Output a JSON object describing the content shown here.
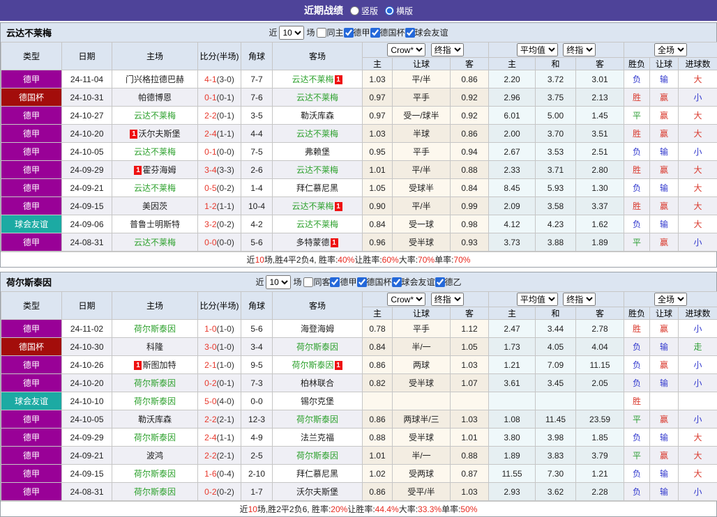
{
  "top": {
    "title": "近期战绩",
    "radios": [
      {
        "label": "竖版",
        "checked": false
      },
      {
        "label": "横版",
        "checked": true
      }
    ]
  },
  "colors": {
    "topbar": "#4e4399",
    "header_bg": "#dce5f1",
    "team_green": "#2da12d",
    "score_red": "#e8382c",
    "badge_red": "#ee1111",
    "summary_red": "#e8281e",
    "type_map": {
      "德甲": "#990197",
      "德国杯": "#a30d0b",
      "球会友谊": "#1caaa3"
    },
    "result_map": {
      "胜": "#d9382c",
      "赢": "#d9382c",
      "大": "#d9382c",
      "负": "#3037cd",
      "输": "#3037cd",
      "小": "#3037cd",
      "平": "#2d9e35",
      "走": "#2d9e35"
    }
  },
  "sections": [
    {
      "team": "云达不莱梅",
      "filter": {
        "near_label": "近",
        "count": "10",
        "games_label": "场",
        "checkboxes": [
          {
            "label": "同主",
            "checked": false
          },
          {
            "label": "德甲",
            "checked": true
          },
          {
            "label": "德国杯",
            "checked": true
          },
          {
            "label": "球会友谊",
            "checked": true
          }
        ]
      },
      "header": {
        "cols": [
          "类型",
          "日期",
          "主场",
          "比分(半场)",
          "角球",
          "客场"
        ],
        "selects": {
          "crow": "Crow*",
          "crow_final": "终指",
          "avg": "平均值",
          "avg_final": "终指",
          "scope": "全场"
        },
        "subs": [
          "主",
          "让球",
          "客",
          "主",
          "和",
          "客",
          "胜负",
          "让球",
          "进球数"
        ]
      },
      "rows": [
        {
          "type": "德甲",
          "date": "24-11-04",
          "home": "门兴格拉德巴赫",
          "home_green": false,
          "home_badge": "none",
          "score": "4-1",
          "half": "(3-0)",
          "corners": "7-7",
          "away": "云达不莱梅",
          "away_green": true,
          "away_badge": "after",
          "odds": [
            "1.03",
            "平/半",
            "0.86"
          ],
          "avg": [
            "2.20",
            "3.72",
            "3.01"
          ],
          "results": [
            "负",
            "输",
            "大"
          ]
        },
        {
          "type": "德国杯",
          "date": "24-10-31",
          "home": "帕德博恩",
          "home_green": false,
          "home_badge": "none",
          "score": "0-1",
          "half": "(0-1)",
          "corners": "7-6",
          "away": "云达不莱梅",
          "away_green": true,
          "away_badge": "none",
          "odds": [
            "0.97",
            "平手",
            "0.92"
          ],
          "avg": [
            "2.96",
            "3.75",
            "2.13"
          ],
          "results": [
            "胜",
            "赢",
            "小"
          ]
        },
        {
          "type": "德甲",
          "date": "24-10-27",
          "home": "云达不莱梅",
          "home_green": true,
          "home_badge": "none",
          "score": "2-2",
          "half": "(0-1)",
          "corners": "3-5",
          "away": "勒沃库森",
          "away_green": false,
          "away_badge": "none",
          "odds": [
            "0.97",
            "受一/球半",
            "0.92"
          ],
          "avg": [
            "6.01",
            "5.00",
            "1.45"
          ],
          "results": [
            "平",
            "赢",
            "大"
          ]
        },
        {
          "type": "德甲",
          "date": "24-10-20",
          "home": "沃尔夫斯堡",
          "home_green": false,
          "home_badge": "before",
          "score": "2-4",
          "half": "(1-1)",
          "corners": "4-4",
          "away": "云达不莱梅",
          "away_green": true,
          "away_badge": "none",
          "odds": [
            "1.03",
            "半球",
            "0.86"
          ],
          "avg": [
            "2.00",
            "3.70",
            "3.51"
          ],
          "results": [
            "胜",
            "赢",
            "大"
          ]
        },
        {
          "type": "德甲",
          "date": "24-10-05",
          "home": "云达不莱梅",
          "home_green": true,
          "home_badge": "none",
          "score": "0-1",
          "half": "(0-0)",
          "corners": "7-5",
          "away": "弗赖堡",
          "away_green": false,
          "away_badge": "none",
          "odds": [
            "0.95",
            "平手",
            "0.94"
          ],
          "avg": [
            "2.67",
            "3.53",
            "2.51"
          ],
          "results": [
            "负",
            "输",
            "小"
          ]
        },
        {
          "type": "德甲",
          "date": "24-09-29",
          "home": "霍芬海姆",
          "home_green": false,
          "home_badge": "before",
          "score": "3-4",
          "half": "(3-3)",
          "corners": "2-6",
          "away": "云达不莱梅",
          "away_green": true,
          "away_badge": "none",
          "odds": [
            "1.01",
            "平/半",
            "0.88"
          ],
          "avg": [
            "2.33",
            "3.71",
            "2.80"
          ],
          "results": [
            "胜",
            "赢",
            "大"
          ]
        },
        {
          "type": "德甲",
          "date": "24-09-21",
          "home": "云达不莱梅",
          "home_green": true,
          "home_badge": "none",
          "score": "0-5",
          "half": "(0-2)",
          "corners": "1-4",
          "away": "拜仁慕尼黑",
          "away_green": false,
          "away_badge": "none",
          "odds": [
            "1.05",
            "受球半",
            "0.84"
          ],
          "avg": [
            "8.45",
            "5.93",
            "1.30"
          ],
          "results": [
            "负",
            "输",
            "大"
          ]
        },
        {
          "type": "德甲",
          "date": "24-09-15",
          "home": "美因茨",
          "home_green": false,
          "home_badge": "none",
          "score": "1-2",
          "half": "(1-1)",
          "corners": "10-4",
          "away": "云达不莱梅",
          "away_green": true,
          "away_badge": "after",
          "odds": [
            "0.90",
            "平/半",
            "0.99"
          ],
          "avg": [
            "2.09",
            "3.58",
            "3.37"
          ],
          "results": [
            "胜",
            "赢",
            "大"
          ]
        },
        {
          "type": "球会友谊",
          "date": "24-09-06",
          "home": "普鲁士明斯特",
          "home_green": false,
          "home_badge": "none",
          "score": "3-2",
          "half": "(0-2)",
          "corners": "4-2",
          "away": "云达不莱梅",
          "away_green": true,
          "away_badge": "none",
          "odds": [
            "0.84",
            "受一球",
            "0.98"
          ],
          "avg": [
            "4.12",
            "4.23",
            "1.62"
          ],
          "results": [
            "负",
            "输",
            "大"
          ]
        },
        {
          "type": "德甲",
          "date": "24-08-31",
          "home": "云达不莱梅",
          "home_green": true,
          "home_badge": "none",
          "score": "0-0",
          "half": "(0-0)",
          "corners": "5-6",
          "away": "多特蒙德",
          "away_green": false,
          "away_badge": "after",
          "odds": [
            "0.96",
            "受半球",
            "0.93"
          ],
          "avg": [
            "3.73",
            "3.88",
            "1.89"
          ],
          "results": [
            "平",
            "赢",
            "小"
          ]
        }
      ],
      "summary": [
        {
          "t": "近",
          "red": false
        },
        {
          "t": "10",
          "red": true
        },
        {
          "t": "场,胜4平2负4, 胜率:",
          "red": false
        },
        {
          "t": "40%",
          "red": true
        },
        {
          "t": " 让胜率:",
          "red": false
        },
        {
          "t": "60%",
          "red": true
        },
        {
          "t": " 大率:",
          "red": false
        },
        {
          "t": "70%",
          "red": true
        },
        {
          "t": " 单率:",
          "red": false
        },
        {
          "t": "70%",
          "red": true
        }
      ]
    },
    {
      "team": "荷尔斯泰因",
      "filter": {
        "near_label": "近",
        "count": "10",
        "games_label": "场",
        "checkboxes": [
          {
            "label": "同客",
            "checked": false
          },
          {
            "label": "德甲",
            "checked": true
          },
          {
            "label": "德国杯",
            "checked": true
          },
          {
            "label": "球会友谊",
            "checked": true
          },
          {
            "label": "德乙",
            "checked": true
          }
        ]
      },
      "header": {
        "cols": [
          "类型",
          "日期",
          "主场",
          "比分(半场)",
          "角球",
          "客场"
        ],
        "selects": {
          "crow": "Crow*",
          "crow_final": "终指",
          "avg": "平均值",
          "avg_final": "终指",
          "scope": "全场"
        },
        "subs": [
          "主",
          "让球",
          "客",
          "主",
          "和",
          "客",
          "胜负",
          "让球",
          "进球数"
        ]
      },
      "rows": [
        {
          "type": "德甲",
          "date": "24-11-02",
          "home": "荷尔斯泰因",
          "home_green": true,
          "home_badge": "none",
          "score": "1-0",
          "half": "(1-0)",
          "corners": "5-6",
          "away": "海登海姆",
          "away_green": false,
          "away_badge": "none",
          "odds": [
            "0.78",
            "平手",
            "1.12"
          ],
          "avg": [
            "2.47",
            "3.44",
            "2.78"
          ],
          "results": [
            "胜",
            "赢",
            "小"
          ]
        },
        {
          "type": "德国杯",
          "date": "24-10-30",
          "home": "科隆",
          "home_green": false,
          "home_badge": "none",
          "score": "3-0",
          "half": "(1-0)",
          "corners": "3-4",
          "away": "荷尔斯泰因",
          "away_green": true,
          "away_badge": "none",
          "odds": [
            "0.84",
            "半/一",
            "1.05"
          ],
          "avg": [
            "1.73",
            "4.05",
            "4.04"
          ],
          "results": [
            "负",
            "输",
            "走"
          ]
        },
        {
          "type": "德甲",
          "date": "24-10-26",
          "home": "斯图加特",
          "home_green": false,
          "home_badge": "before",
          "score": "2-1",
          "half": "(1-0)",
          "corners": "9-5",
          "away": "荷尔斯泰因",
          "away_green": true,
          "away_badge": "after",
          "odds": [
            "0.86",
            "两球",
            "1.03"
          ],
          "avg": [
            "1.21",
            "7.09",
            "11.15"
          ],
          "results": [
            "负",
            "赢",
            "小"
          ]
        },
        {
          "type": "德甲",
          "date": "24-10-20",
          "home": "荷尔斯泰因",
          "home_green": true,
          "home_badge": "none",
          "score": "0-2",
          "half": "(0-1)",
          "corners": "7-3",
          "away": "柏林联合",
          "away_green": false,
          "away_badge": "none",
          "odds": [
            "0.82",
            "受半球",
            "1.07"
          ],
          "avg": [
            "3.61",
            "3.45",
            "2.05"
          ],
          "results": [
            "负",
            "输",
            "小"
          ]
        },
        {
          "type": "球会友谊",
          "date": "24-10-10",
          "home": "荷尔斯泰因",
          "home_green": true,
          "home_badge": "none",
          "score": "5-0",
          "half": "(4-0)",
          "corners": "0-0",
          "away": "锡尔克堡",
          "away_green": false,
          "away_badge": "none",
          "odds": [
            "",
            "",
            ""
          ],
          "avg": [
            "",
            "",
            ""
          ],
          "results": [
            "胜",
            "",
            ""
          ]
        },
        {
          "type": "德甲",
          "date": "24-10-05",
          "home": "勒沃库森",
          "home_green": false,
          "home_badge": "none",
          "score": "2-2",
          "half": "(2-1)",
          "corners": "12-3",
          "away": "荷尔斯泰因",
          "away_green": true,
          "away_badge": "none",
          "odds": [
            "0.86",
            "两球半/三",
            "1.03"
          ],
          "avg": [
            "1.08",
            "11.45",
            "23.59"
          ],
          "results": [
            "平",
            "赢",
            "小"
          ]
        },
        {
          "type": "德甲",
          "date": "24-09-29",
          "home": "荷尔斯泰因",
          "home_green": true,
          "home_badge": "none",
          "score": "2-4",
          "half": "(1-1)",
          "corners": "4-9",
          "away": "法兰克福",
          "away_green": false,
          "away_badge": "none",
          "odds": [
            "0.88",
            "受半球",
            "1.01"
          ],
          "avg": [
            "3.80",
            "3.98",
            "1.85"
          ],
          "results": [
            "负",
            "输",
            "大"
          ]
        },
        {
          "type": "德甲",
          "date": "24-09-21",
          "home": "波鸿",
          "home_green": false,
          "home_badge": "none",
          "score": "2-2",
          "half": "(2-1)",
          "corners": "2-5",
          "away": "荷尔斯泰因",
          "away_green": true,
          "away_badge": "none",
          "odds": [
            "1.01",
            "半/一",
            "0.88"
          ],
          "avg": [
            "1.89",
            "3.83",
            "3.79"
          ],
          "results": [
            "平",
            "赢",
            "大"
          ]
        },
        {
          "type": "德甲",
          "date": "24-09-15",
          "home": "荷尔斯泰因",
          "home_green": true,
          "home_badge": "none",
          "score": "1-6",
          "half": "(0-4)",
          "corners": "2-10",
          "away": "拜仁慕尼黑",
          "away_green": false,
          "away_badge": "none",
          "odds": [
            "1.02",
            "受两球",
            "0.87"
          ],
          "avg": [
            "11.55",
            "7.30",
            "1.21"
          ],
          "results": [
            "负",
            "输",
            "大"
          ]
        },
        {
          "type": "德甲",
          "date": "24-08-31",
          "home": "荷尔斯泰因",
          "home_green": true,
          "home_badge": "none",
          "score": "0-2",
          "half": "(0-2)",
          "corners": "1-7",
          "away": "沃尔夫斯堡",
          "away_green": false,
          "away_badge": "none",
          "odds": [
            "0.86",
            "受平/半",
            "1.03"
          ],
          "avg": [
            "2.93",
            "3.62",
            "2.28"
          ],
          "results": [
            "负",
            "输",
            "小"
          ]
        }
      ],
      "summary": [
        {
          "t": "近",
          "red": false
        },
        {
          "t": "10",
          "red": true
        },
        {
          "t": "场,胜2平2负6, 胜率:",
          "red": false
        },
        {
          "t": "20%",
          "red": true
        },
        {
          "t": " 让胜率:",
          "red": false
        },
        {
          "t": "44.4%",
          "red": true
        },
        {
          "t": " 大率:",
          "red": false
        },
        {
          "t": "33.3%",
          "red": true
        },
        {
          "t": " 单率:",
          "red": false
        },
        {
          "t": "50%",
          "red": true
        }
      ]
    }
  ]
}
